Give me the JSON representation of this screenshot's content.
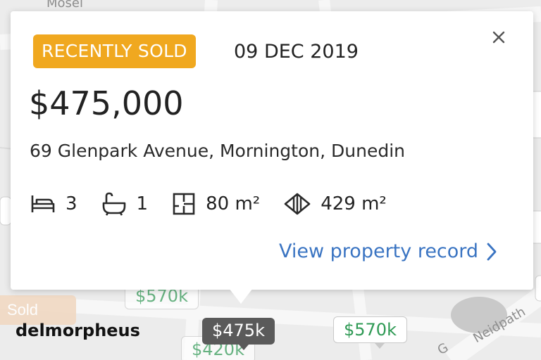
{
  "popup": {
    "status_badge": "RECENTLY SOLD",
    "sold_date": "09 DEC 2019",
    "price": "$475,000",
    "address": "69 Glenpark Avenue, Mornington, Dunedin",
    "features": {
      "bedrooms": "3",
      "bathrooms": "1",
      "floor_area": "80 m²",
      "land_area": "429 m²"
    },
    "link_label": "View property record",
    "colors": {
      "badge": "#f0a81f",
      "link": "#3a74c2"
    },
    "icons": [
      "bed-icon",
      "bath-icon",
      "floor-area-icon",
      "land-area-icon",
      "chevron-right-icon",
      "close-icon"
    ]
  },
  "map": {
    "street_labels": [
      "Mosel",
      "G",
      "Neidpath"
    ],
    "markers": {
      "selected": "$475k",
      "green_1": "$570k",
      "green_2": "$570k",
      "partial": "$420k"
    },
    "sold_chip": "Sold",
    "colors": {
      "marker_text": "#2f9a55",
      "selected_marker": "#5a5a5a"
    }
  },
  "watermark": "delmorpheus"
}
